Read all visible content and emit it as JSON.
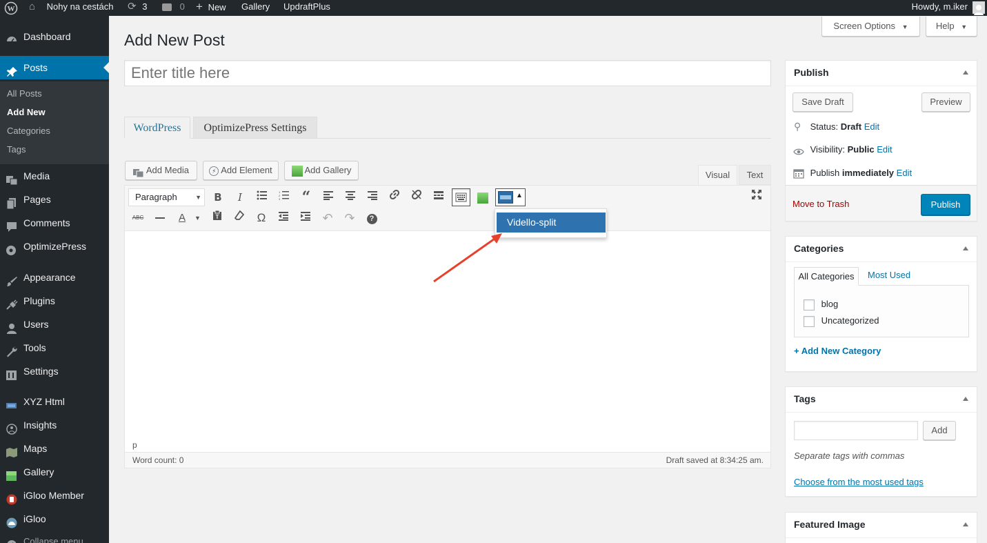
{
  "admin_bar": {
    "site_name": "Nohy na cestách",
    "updates_count": "3",
    "comments_count": "0",
    "new_label": "New",
    "gallery_label": "Gallery",
    "updraft_label": "UpdraftPlus",
    "howdy": "Howdy, m.iker"
  },
  "sidebar": {
    "items": [
      {
        "label": "Dashboard",
        "icon": "dashboard-icon"
      },
      {
        "label": "Posts",
        "icon": "pushpin-icon"
      },
      {
        "label": "Media",
        "icon": "media-icon"
      },
      {
        "label": "Pages",
        "icon": "pages-icon"
      },
      {
        "label": "Comments",
        "icon": "comment-icon"
      },
      {
        "label": "OptimizePress",
        "icon": "optimizepress-icon"
      },
      {
        "label": "Appearance",
        "icon": "paintbrush-icon"
      },
      {
        "label": "Plugins",
        "icon": "plugin-icon"
      },
      {
        "label": "Users",
        "icon": "users-icon"
      },
      {
        "label": "Tools",
        "icon": "wrench-icon"
      },
      {
        "label": "Settings",
        "icon": "settings-icon"
      },
      {
        "label": "XYZ Html",
        "icon": "xyz-html-icon"
      },
      {
        "label": "Insights",
        "icon": "insights-icon"
      },
      {
        "label": "Maps",
        "icon": "maps-icon"
      },
      {
        "label": "Gallery",
        "icon": "gallery-icon"
      },
      {
        "label": "iGloo Member",
        "icon": "igloo-member-icon"
      },
      {
        "label": "iGloo",
        "icon": "igloo-icon"
      }
    ],
    "submenu": [
      "All Posts",
      "Add New",
      "Categories",
      "Tags"
    ],
    "collapse_label": "Collapse menu"
  },
  "header": {
    "screen_options": "Screen Options",
    "help": "Help",
    "page_title": "Add New Post"
  },
  "editor": {
    "title_placeholder": "Enter title here",
    "tabs": [
      "WordPress",
      "OptimizePress Settings"
    ],
    "add_media": "Add Media",
    "add_element": "Add Element",
    "add_gallery": "Add Gallery",
    "visual_tab": "Visual",
    "text_tab": "Text",
    "format_select": "Paragraph",
    "dropdown_item": "Vidello-split",
    "path": "p",
    "word_count": "Word count: 0",
    "draft_saved": "Draft saved at 8:34:25 am."
  },
  "publish": {
    "title": "Publish",
    "save_draft": "Save Draft",
    "preview": "Preview",
    "status_label": "Status:",
    "status_value": "Draft",
    "visibility_label": "Visibility:",
    "visibility_value": "Public",
    "publish_label": "Publish",
    "publish_value": "immediately",
    "edit": "Edit",
    "move_to_trash": "Move to Trash",
    "publish_button": "Publish"
  },
  "categories": {
    "title": "Categories",
    "tab_all": "All Categories",
    "tab_most_used": "Most Used",
    "items": [
      "blog",
      "Uncategorized"
    ],
    "add_new": "+ Add New Category"
  },
  "tags": {
    "title": "Tags",
    "add_button": "Add",
    "hint": "Separate tags with commas",
    "choose_link": "Choose from the most used tags"
  },
  "featured_image": {
    "title": "Featured Image"
  },
  "colors": {
    "admin_bar_bg": "#23282d",
    "accent": "#0073aa",
    "primary_button": "#0085ba",
    "trash": "#a00",
    "arrow": "#e8412b"
  }
}
